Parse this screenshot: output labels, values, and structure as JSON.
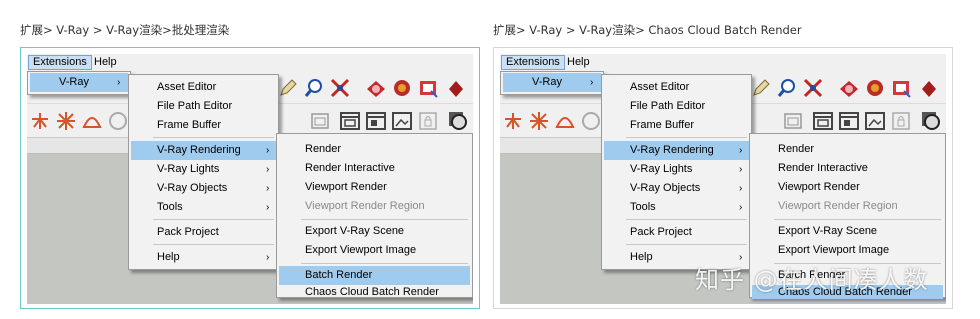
{
  "captions": {
    "left": "扩展> V-Ray > V-Ray渲染>批处理渲染",
    "right": "扩展> V-Ray > V-Ray渲染> Chaos Cloud Batch Render"
  },
  "menubar": {
    "extensions": "Extensions",
    "help": "Help"
  },
  "extensions_menu": {
    "vray": "V-Ray"
  },
  "arrow": "›",
  "vray_menu": {
    "asset_editor": "Asset Editor",
    "file_path_editor": "File Path Editor",
    "frame_buffer": "Frame Buffer",
    "vray_rendering": "V-Ray Rendering",
    "vray_lights": "V-Ray Lights",
    "vray_objects": "V-Ray Objects",
    "tools": "Tools",
    "pack_project": "Pack Project",
    "help": "Help"
  },
  "rendering_menu": {
    "render": "Render",
    "render_interactive": "Render Interactive",
    "viewport_render": "Viewport Render",
    "viewport_render_region": "Viewport Render Region",
    "export_vray_scene": "Export V-Ray Scene",
    "export_viewport_image": "Export Viewport Image",
    "batch_render": "Batch Render",
    "chaos_cloud_batch_render": "Chaos Cloud Batch Render"
  },
  "watermark": "知乎 @在人间凑人数",
  "colors": {
    "highlight": "#9fcbee",
    "panel_accent": "#6cc9c9",
    "menu_bg": "#f2f2f2",
    "canvas": "#c4c6c2"
  }
}
